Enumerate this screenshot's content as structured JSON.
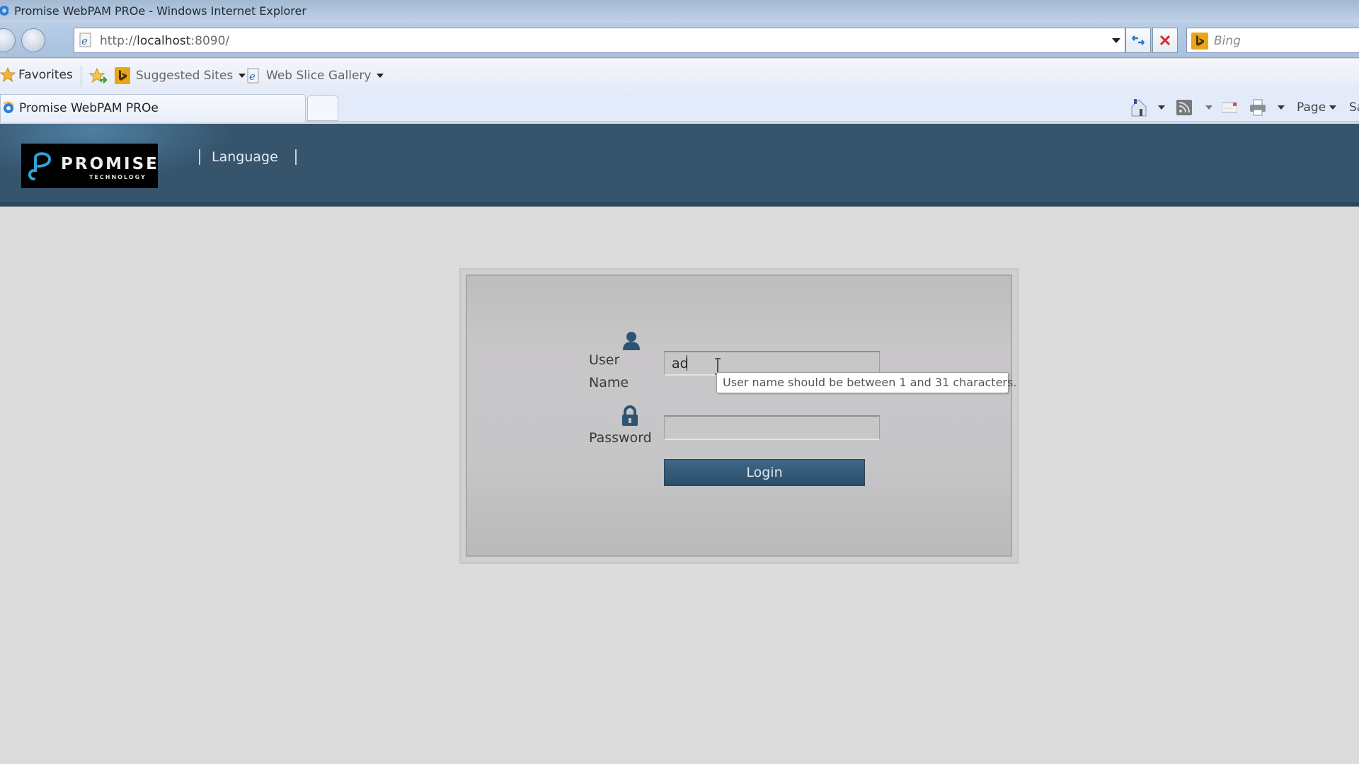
{
  "browser": {
    "window_title": "Promise WebPAM PROe - Windows Internet Explorer",
    "address_url_prefix": "http://",
    "address_url_host": "localhost",
    "address_url_suffix": ":8090/",
    "search_placeholder": "Bing",
    "favorites_bar": {
      "favorites_label": "Favorites",
      "items": [
        {
          "label": "Suggested Sites",
          "icon": "bing-icon"
        },
        {
          "label": "Web Slice Gallery",
          "icon": "ie-page-icon"
        }
      ]
    },
    "tab": {
      "title": "Promise WebPAM PROe"
    },
    "command_bar": {
      "page_label": "Page",
      "safety_label_truncated": "Sa"
    }
  },
  "header": {
    "logo_word": "PROMISE",
    "logo_sub": "TECHNOLOGY",
    "nav_items": [
      {
        "label": "Language"
      }
    ]
  },
  "login": {
    "username_label_line1": "User",
    "username_label_line2": "Name",
    "username_value": "ad",
    "username_tooltip": "User name should be between 1 and 31 characters.",
    "password_label": "Password",
    "password_value": "",
    "login_button": "Login"
  },
  "colors": {
    "header_bg": "#36546c",
    "button_bg": "#2f5170",
    "icon_color": "#2e5474",
    "page_bg": "#dcdcdc"
  }
}
